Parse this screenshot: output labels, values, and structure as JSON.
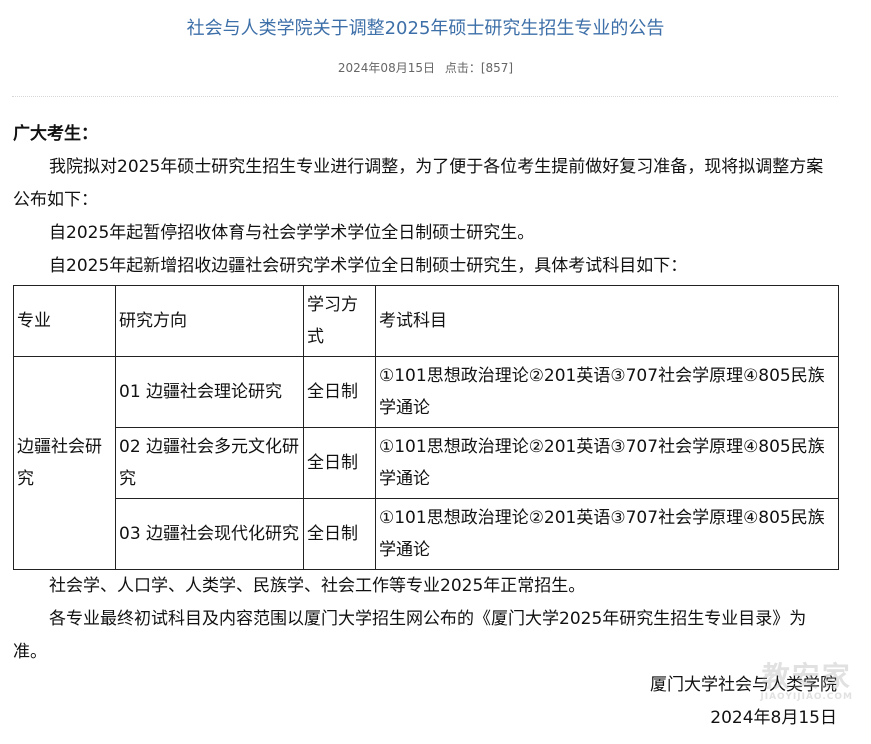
{
  "header": {
    "title": "社会与人类学院关于调整2025年硕士研究生招生专业的公告",
    "date": "2024年08月15日",
    "clicks_label": "点击：[857]"
  },
  "body": {
    "greeting": "广大考生：",
    "intro": "我院拟对2025年硕士研究生招生专业进行调整，为了便于各位考生提前做好复习准备，现将拟调整方案公布如下：",
    "suspend": "自2025年起暂停招收体育与社会学学术学位全日制硕士研究生。",
    "add": "自2025年起新增招收边疆社会研究学术学位全日制硕士研究生，具体考试科目如下："
  },
  "table": {
    "headers": [
      "专业",
      "研究方向",
      "学习方式",
      "考试科目"
    ],
    "major": "边疆社会研究",
    "rows": [
      {
        "direction": "01 边疆社会理论研究",
        "mode": "全日制",
        "subjects": "①101思想政治理论②201英语③707社会学原理④805民族学通论"
      },
      {
        "direction": "02 边疆社会多元文化研究",
        "mode": "全日制",
        "subjects": "①101思想政治理论②201英语③707社会学原理④805民族学通论"
      },
      {
        "direction": "03 边疆社会现代化研究",
        "mode": "全日制",
        "subjects": "①101思想政治理论②201英语③707社会学原理④805民族学通论"
      }
    ]
  },
  "footer": {
    "normal": "社会学、人口学、人类学、民族学、社会工作等专业2025年正常招生。",
    "final": "各专业最终初试科目及内容范围以厦门大学招生网公布的《厦门大学2025年研究生招生专业目录》为准。",
    "signature": "厦门大学社会与人类学院",
    "sign_date": "2024年8月15日"
  },
  "watermark": {
    "text": "教安家",
    "url": "JIAOYIJIAO.COM"
  }
}
